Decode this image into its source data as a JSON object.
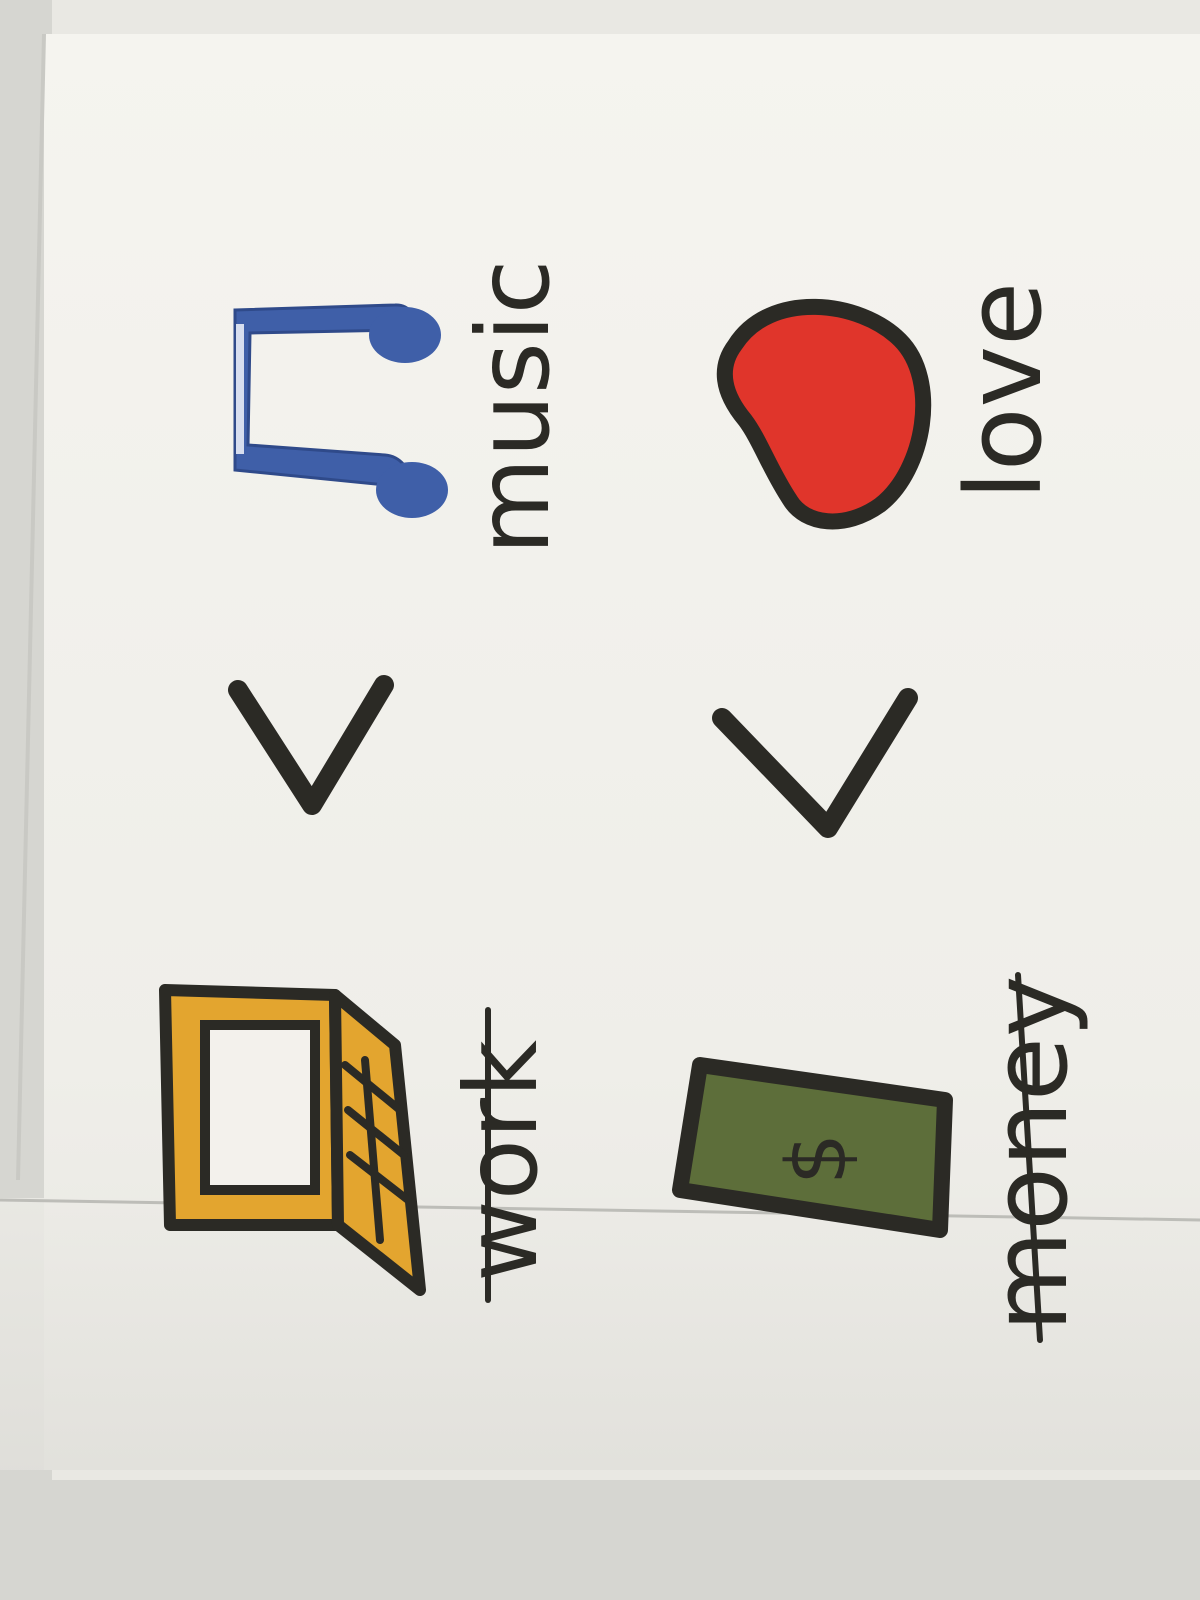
{
  "card": {
    "words": {
      "music": "music",
      "love": "love",
      "work": "work",
      "money": "money"
    },
    "symbols": {
      "top_comparison": "greater-than",
      "bottom_comparison": "greater-than",
      "bill_symbol": "$"
    },
    "crossed_out": [
      "work",
      "money"
    ]
  },
  "icons": {
    "music": "music-note-icon",
    "love": "heart-icon",
    "work": "laptop-icon",
    "money": "dollar-bill-icon"
  },
  "colors": {
    "background": "#d6d6d1",
    "card": "#f2f1ec",
    "ink": "#2b2a25",
    "note_blue": "#3f5fa8",
    "heart_red": "#e0352b",
    "laptop_gold": "#e3a52f",
    "bill_green": "#5d6e3a"
  }
}
